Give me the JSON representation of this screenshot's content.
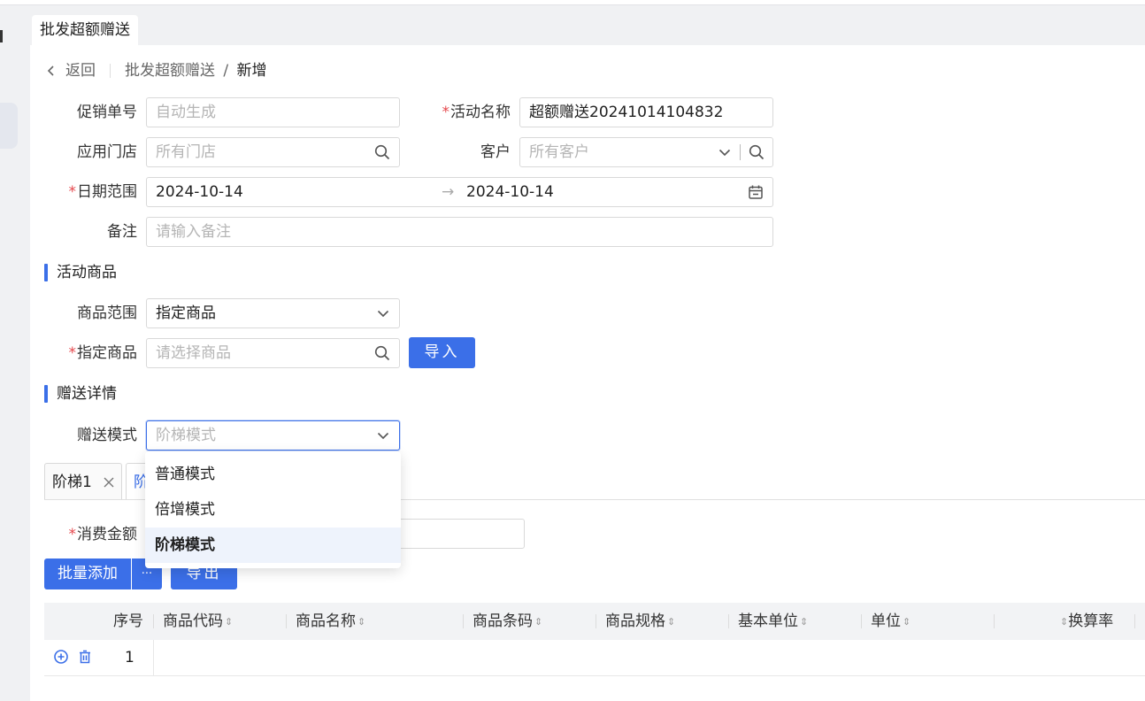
{
  "tab": {
    "label": "批发超额赠送"
  },
  "header": {
    "back_label": "返回",
    "breadcrumb_parent": "批发超额赠送",
    "breadcrumb_sep": "/",
    "breadcrumb_current": "新增"
  },
  "form": {
    "promo_no": {
      "label": "促销单号",
      "placeholder": "自动生成"
    },
    "activity_name": {
      "label": "活动名称",
      "value": "超额赠送20241014104832"
    },
    "store": {
      "label": "应用门店",
      "placeholder": "所有门店"
    },
    "customer": {
      "label": "客户",
      "placeholder": "所有客户"
    },
    "date_range": {
      "label": "日期范围",
      "start": "2024-10-14",
      "sep": "→",
      "end": "2024-10-14"
    },
    "remark": {
      "label": "备注",
      "placeholder": "请输入备注"
    }
  },
  "goods_section": {
    "title": "活动商品",
    "scope": {
      "label": "商品范围",
      "value": "指定商品"
    },
    "specified": {
      "label": "指定商品",
      "placeholder": "请选择商品"
    },
    "import_label": "导入"
  },
  "gift_section": {
    "title": "赠送详情",
    "mode": {
      "label": "赠送模式",
      "placeholder": "阶梯模式"
    },
    "mode_options": [
      "普通模式",
      "倍增模式",
      "阶梯模式"
    ],
    "active_option": "阶梯模式"
  },
  "ladder_tabs": [
    {
      "label": "阶梯1"
    },
    {
      "label": "阶"
    }
  ],
  "spend": {
    "label": "消费金额"
  },
  "actions": {
    "batch_add": "批量添加",
    "more": "···",
    "export": "导出"
  },
  "table": {
    "columns": [
      "序号",
      "商品代码",
      "商品名称",
      "商品条码",
      "商品规格",
      "基本单位",
      "单位",
      "换算率"
    ],
    "rows": [
      {
        "index": "1"
      }
    ]
  },
  "colors": {
    "accent": "#3b6fe8",
    "required": "#e5484d",
    "placeholder": "#b5b5b5"
  },
  "icons": [
    "chevron-left-icon",
    "search-icon",
    "chevron-down-icon",
    "calendar-icon",
    "close-icon",
    "plus-circle-icon",
    "trash-icon"
  ]
}
